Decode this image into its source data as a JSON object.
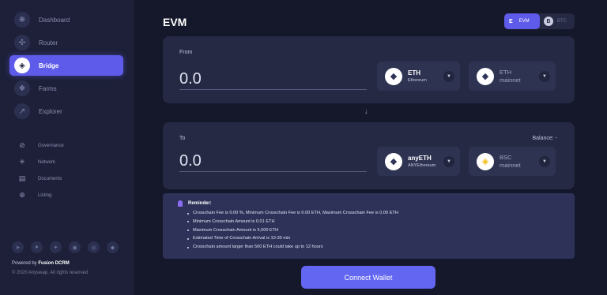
{
  "sidebar": {
    "nav": [
      {
        "label": "Dashboard",
        "icon": "dashboard-icon",
        "glyph": "❋"
      },
      {
        "label": "Router",
        "icon": "router-icon",
        "glyph": "✣"
      },
      {
        "label": "Bridge",
        "icon": "bridge-icon",
        "glyph": "◈"
      },
      {
        "label": "Farms",
        "icon": "farms-icon",
        "glyph": "❖"
      },
      {
        "label": "Explorer",
        "icon": "explorer-icon",
        "glyph": "↗"
      }
    ],
    "active_index": 2,
    "sub": [
      {
        "label": "Governance",
        "icon": "governance-icon",
        "glyph": "⊘"
      },
      {
        "label": "Network",
        "icon": "network-icon",
        "glyph": "✳"
      },
      {
        "label": "Documents",
        "icon": "documents-icon",
        "glyph": "▤"
      },
      {
        "label": "Listing",
        "icon": "listing-icon",
        "glyph": "⊕"
      }
    ],
    "socials": [
      "telegram-icon",
      "medium-icon",
      "twitter-icon",
      "github-icon",
      "reddit-icon",
      "coinmarketcap-icon"
    ],
    "powered_prefix": "Powered by ",
    "powered_brand": "Fusion DCRM",
    "copyright": "© 2020 Anyswap. All rights reserved"
  },
  "header": {
    "title": "EVM",
    "toggle_evm_letter": "E",
    "toggle_evm_label": "EVM",
    "toggle_btc_letter": "B",
    "toggle_btc_label": "BTC"
  },
  "from": {
    "label": "From",
    "amount": "0.0",
    "token_symbol": "ETH",
    "token_name": "Ethereum",
    "network_line1": "ETH",
    "network_line2": "mainnet"
  },
  "to": {
    "label": "To",
    "balance": "Balance: -",
    "amount": "0.0",
    "token_symbol": "anyETH",
    "token_name": "ANYEthereum",
    "network_line1": "BSC",
    "network_line2": "mainnet"
  },
  "reminder": {
    "title": "Reminder:",
    "items": [
      "Crosschain Fee is 0.00 %, Minimum Crosschain Fee is 0.00 ETH, Maximum Crosschain Fee is 0.00 ETH",
      "Minimum Crosschain Amount is 0.01 ETH",
      "Maximum Crosschain Amount is 5,000 ETH",
      "Estimated Time of Crosschain Arrival is 10-30 min",
      "Crosschain amount larger than 500 ETH could take up to 12 hours"
    ]
  },
  "connect_label": "Connect Wallet",
  "colors": {
    "accent": "#5f5bea",
    "background": "#15172b",
    "sidebar": "#1d2038",
    "card": "#262943"
  }
}
